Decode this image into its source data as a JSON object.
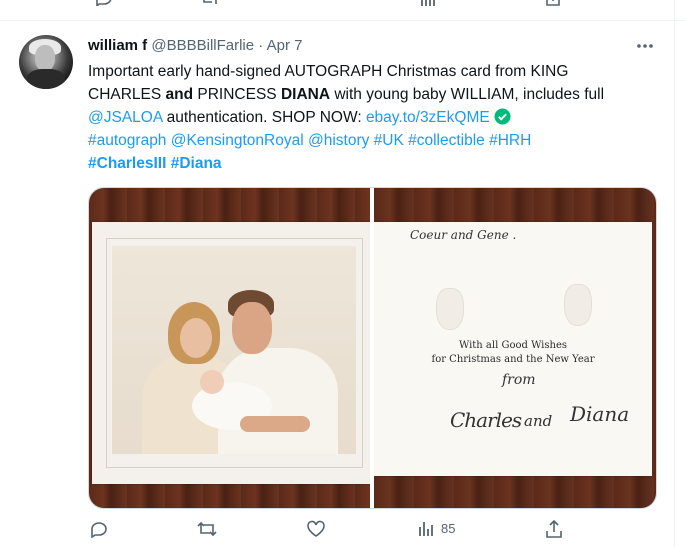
{
  "tweet": {
    "display_name": "william f",
    "handle": "@BBBBillFarlie",
    "separator": "·",
    "date": "Apr 7",
    "text": {
      "line1": "Important early hand-signed AUTOGRAPH Christmas card from KING",
      "line2_a": "CHARLES ",
      "line2_b": "and",
      "line2_c": " PRINCESS ",
      "line2_d": "DIANA",
      "line2_e": " with young baby WILLIAM, includes full",
      "mention": "@JSALOA",
      "line3_mid": " authentication. SHOP NOW: ",
      "url": "ebay.to/3zEkQME",
      "hashtags_line4": "#autograph @KensingtonRoyal @history #UK #collectible #HRH",
      "hashtags_line5": "#CharlesIII #Diana"
    }
  },
  "card": {
    "greeting": "With all Good Wishes",
    "greeting2": "for Christmas and the New Year"
  },
  "actions": {
    "views_count": "85"
  },
  "colors": {
    "link": "#1d9bf0",
    "muted": "#536471",
    "text": "#0f1419"
  }
}
